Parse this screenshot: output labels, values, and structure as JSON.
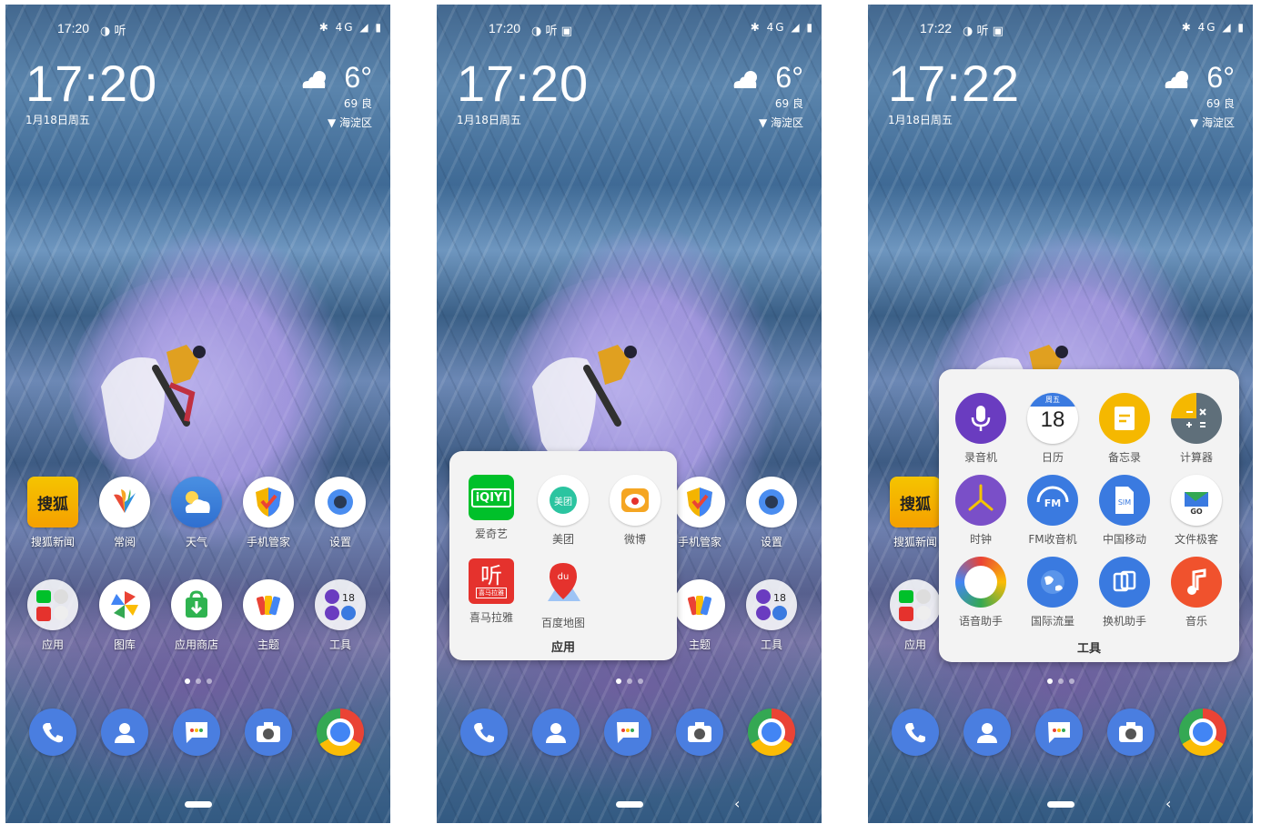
{
  "screens": [
    {
      "status": {
        "time": "17:20",
        "indicators": "◑ 听",
        "right": "✱ 4G ◢ ▮"
      },
      "clock": "17:20",
      "date": "1月18日周五",
      "weather": {
        "temp": "6°",
        "aqi": "69 良",
        "location": "▼ 海淀区"
      },
      "row1": [
        "搜狐新闻",
        "常阅",
        "天气",
        "手机管家",
        "设置"
      ],
      "row2": [
        "应用",
        "图库",
        "应用商店",
        "主题",
        "工具"
      ]
    },
    {
      "status": {
        "time": "17:20",
        "indicators": "◑ 听 ▣",
        "right": "✱ 4G ◢ ▮"
      },
      "clock": "17:20",
      "date": "1月18日周五",
      "weather": {
        "temp": "6°",
        "aqi": "69 良",
        "location": "▼ 海淀区"
      },
      "row1_visible": [
        "手机管家",
        "设置"
      ],
      "row2_visible": [
        "主题",
        "工具"
      ],
      "folder": {
        "title": "应用",
        "apps": [
          "爱奇艺",
          "美团",
          "微博",
          "喜马拉雅",
          "百度地图"
        ],
        "icon_text": {
          "iqiyi": "iQIYI",
          "meituan": "美团",
          "ximalaya_big": "听",
          "ximalaya_small": "喜马拉雅",
          "baidu": "du"
        }
      }
    },
    {
      "status": {
        "time": "17:22",
        "indicators": "◑ 听 ▣",
        "right": "✱ 4G ◢ ▮"
      },
      "clock": "17:22",
      "date": "1月18日周五",
      "weather": {
        "temp": "6°",
        "aqi": "69 良",
        "location": "▼ 海淀区"
      },
      "row1_visible": [
        "搜狐新闻"
      ],
      "row2_visible": [
        "应用"
      ],
      "folder": {
        "title": "工具",
        "apps": [
          "录音机",
          "日历",
          "备忘录",
          "计算器",
          "时钟",
          "FM收音机",
          "中国移动",
          "文件极客",
          "语音助手",
          "国际流量",
          "换机助手",
          "音乐"
        ],
        "icon_text": {
          "cal_day": "周五",
          "cal_num": "18",
          "fm": "FM",
          "sim": "SIM",
          "go": "GO"
        }
      }
    }
  ],
  "icon_text": {
    "sohu": "搜狐",
    "tools_cal": "18"
  },
  "colors": {
    "accent_blue": "#4a7ee0",
    "chrome_green": "#34a853",
    "chrome_red": "#ea4335",
    "chrome_yellow": "#fbbc05",
    "iqiyi_green": "#00c02a",
    "ximalaya_red": "#e5322d"
  }
}
